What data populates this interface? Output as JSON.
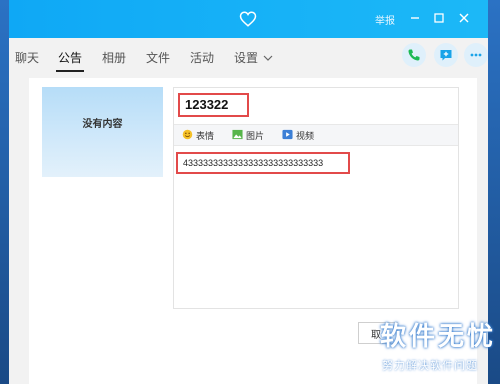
{
  "titlebar": {
    "report_label": "举报"
  },
  "tabs": [
    {
      "label": "聊天"
    },
    {
      "label": "公告"
    },
    {
      "label": "相册"
    },
    {
      "label": "文件"
    },
    {
      "label": "活动"
    },
    {
      "label": "设置"
    }
  ],
  "active_tab": "公告",
  "announcement": {
    "thumbnail_text": "没有内容",
    "title_value": "123322",
    "toolbar": {
      "emoji_label": "表情",
      "image_label": "图片",
      "video_label": "视频"
    },
    "body_value": "4333333333333333333333333333",
    "bottom_button_label": "取"
  },
  "watermark": {
    "title": "软件无忧",
    "subtitle": "努力解决软件问题"
  },
  "colors": {
    "titlebar": "#16b1f7",
    "highlight_border": "#e24a4a",
    "phone_icon": "#1db954",
    "chat_icon": "#19a3e8"
  },
  "icons": {
    "title": "heart-icon",
    "call": "phone-icon",
    "message": "chat-plus-icon",
    "more": "more-icon"
  }
}
